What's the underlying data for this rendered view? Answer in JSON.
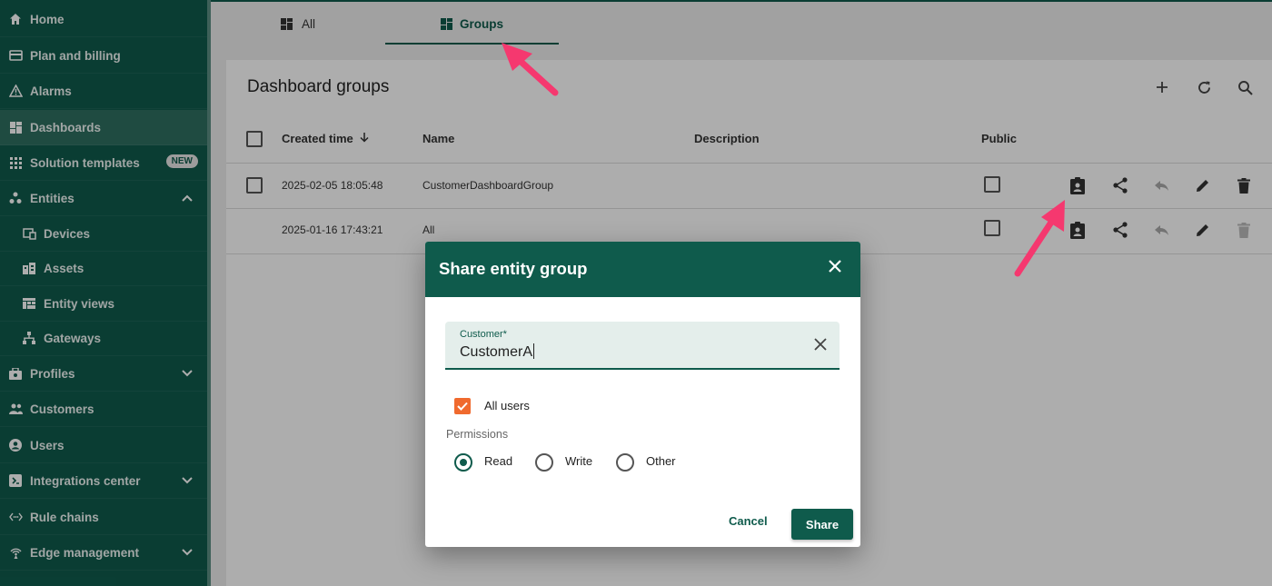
{
  "sidebar": {
    "items": [
      {
        "label": "Home",
        "icon": "home-icon"
      },
      {
        "label": "Plan and billing",
        "icon": "credit-card-icon"
      },
      {
        "label": "Alarms",
        "icon": "warning-icon"
      },
      {
        "label": "Dashboards",
        "icon": "dashboard-icon",
        "active": true
      },
      {
        "label": "Solution templates",
        "icon": "grid-icon",
        "badge": "NEW"
      },
      {
        "label": "Entities",
        "icon": "entities-icon",
        "expanded": true
      },
      {
        "label": "Devices",
        "icon": "device-icon"
      },
      {
        "label": "Assets",
        "icon": "assets-icon"
      },
      {
        "label": "Entity views",
        "icon": "entity-views-icon"
      },
      {
        "label": "Gateways",
        "icon": "gateway-icon"
      },
      {
        "label": "Profiles",
        "icon": "profiles-icon"
      },
      {
        "label": "Customers",
        "icon": "customers-icon"
      },
      {
        "label": "Users",
        "icon": "user-icon"
      },
      {
        "label": "Integrations center",
        "icon": "integrations-icon"
      },
      {
        "label": "Rule chains",
        "icon": "rule-chains-icon"
      },
      {
        "label": "Edge management",
        "icon": "edge-icon"
      }
    ],
    "badge": "NEW"
  },
  "tabs": [
    {
      "label": "All",
      "icon": "dashboard-icon"
    },
    {
      "label": "Groups",
      "icon": "dashboard-icon",
      "active": true
    }
  ],
  "table": {
    "title": "Dashboard groups",
    "columns": {
      "created": "Created time",
      "name": "Name",
      "description": "Description",
      "public": "Public"
    },
    "rows": [
      {
        "created": "2025-02-05 18:05:48",
        "name": "CustomerDashboardGroup",
        "description": ""
      },
      {
        "created": "2025-01-16 17:43:21",
        "name": "All",
        "description": ""
      }
    ]
  },
  "dialog": {
    "title": "Share entity group",
    "customer_label": "Customer*",
    "customer_value": "CustomerA",
    "all_users_label": "All users",
    "all_users_checked": true,
    "permissions_label": "Permissions",
    "options": [
      "Read",
      "Write",
      "Other"
    ],
    "selected": "Read",
    "cancel": "Cancel",
    "share": "Share"
  },
  "colors": {
    "primary": "#0f5b4c",
    "accent_checkbox": "#f06a2e",
    "annotation_arrow": "#f5386f"
  }
}
